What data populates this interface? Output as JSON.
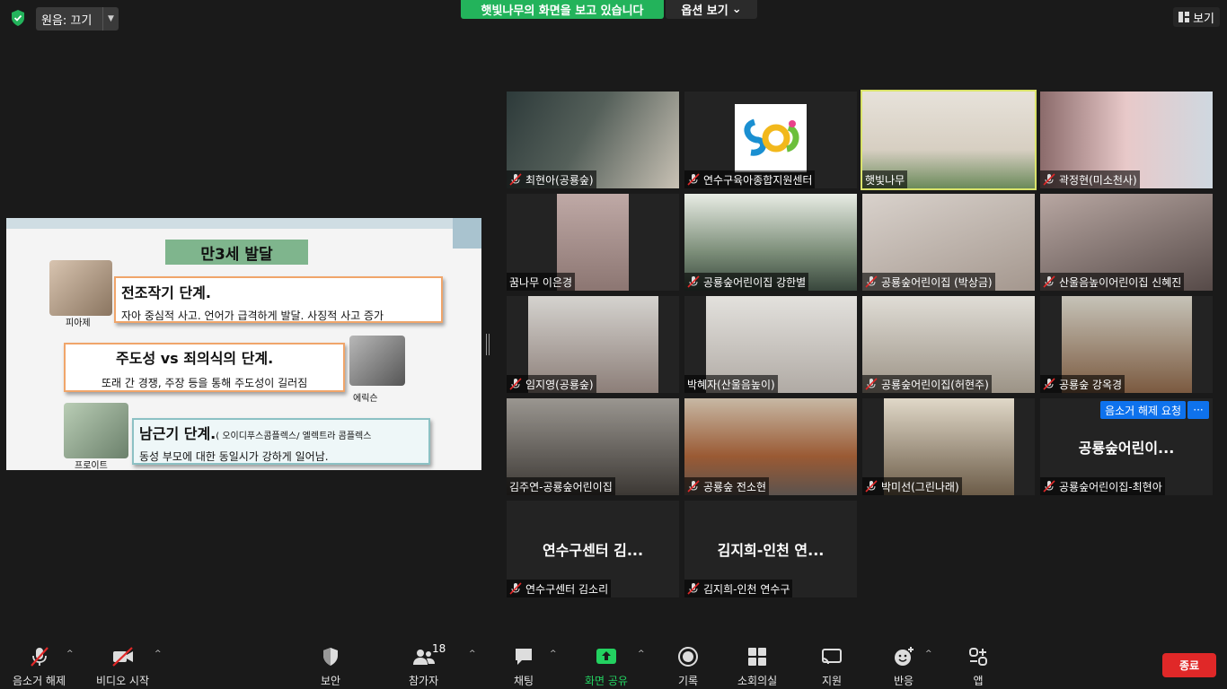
{
  "top": {
    "audio_label": "원음: 끄기",
    "viewing_banner": "햇빛나무의 화면을 보고 있습니다",
    "view_options": "옵션 보기",
    "view_button": "보기"
  },
  "slide": {
    "title": "만3세 발달",
    "captions": [
      "피아제",
      "에릭슨",
      "프로이트"
    ],
    "stage1_heading": "전조작기 단계.",
    "stage1_body": "자아 중심적 사고. 언어가 급격하게 발달.  사징적 사고 증가",
    "stage2_heading": "주도성 vs 죄의식의 단계.",
    "stage2_body": "또래 간 경쟁, 주장 등을 통해 주도성이 길러짐",
    "stage3_heading": "남근기 단계.",
    "stage3_note": "( 오이디푸스콤플렉스/ 엘렉트라 콤플렉스",
    "stage3_body": "동성 부모에 대한 동일시가 강하게 일어남."
  },
  "participants": [
    {
      "name": "최현아(공룡숲)",
      "muted": true
    },
    {
      "name": "연수구육아종합지원센터",
      "muted": true
    },
    {
      "name": "햇빛나무",
      "muted": false,
      "active": true
    },
    {
      "name": "곽정현(미소천사)",
      "muted": true
    },
    {
      "name": "꿈나무 이은경",
      "muted": false
    },
    {
      "name": "공룡숲어린이집 강한별",
      "muted": true
    },
    {
      "name": "공룡숲어린이집 (박상금)",
      "muted": true
    },
    {
      "name": "산울음높이어린이집 신혜진",
      "muted": true
    },
    {
      "name": "임지영(공룡숲)",
      "muted": true
    },
    {
      "name": "박혜자(산울음높이)",
      "muted": false
    },
    {
      "name": "공룡숲어린이집(허현주)",
      "muted": true
    },
    {
      "name": "공룡숲 강옥경",
      "muted": true
    },
    {
      "name": "김주연-공룡숲어린이집",
      "muted": false
    },
    {
      "name": "공룡숲 전소현",
      "muted": true
    },
    {
      "name": "박미선(그린나래)",
      "muted": true
    },
    {
      "name": "공룡숲어린이집-최현아",
      "muted": true,
      "big_name": "공룡숲어린이...",
      "unmute_request": "음소거 해제 요청",
      "more": "···"
    },
    {
      "name": "연수구센터 김소리",
      "muted": true,
      "big_name": "연수구센터 김..."
    },
    {
      "name": "김지희-인천 연수구",
      "muted": true,
      "big_name": "김지희-인천 연..."
    }
  ],
  "toolbar": {
    "unmute": "음소거 해제",
    "start_video": "비디오 시작",
    "security": "보안",
    "participants": "참가자",
    "participant_count": "18",
    "chat": "채팅",
    "share_screen": "화면 공유",
    "record": "기록",
    "breakout": "소회의실",
    "support": "지원",
    "reactions": "반응",
    "apps": "앱",
    "end": "종료"
  },
  "colors": {
    "share_green": "#23b35b",
    "active_speaker": "#d9e36a",
    "end_red": "#e02828",
    "request_blue": "#0e72ed"
  }
}
